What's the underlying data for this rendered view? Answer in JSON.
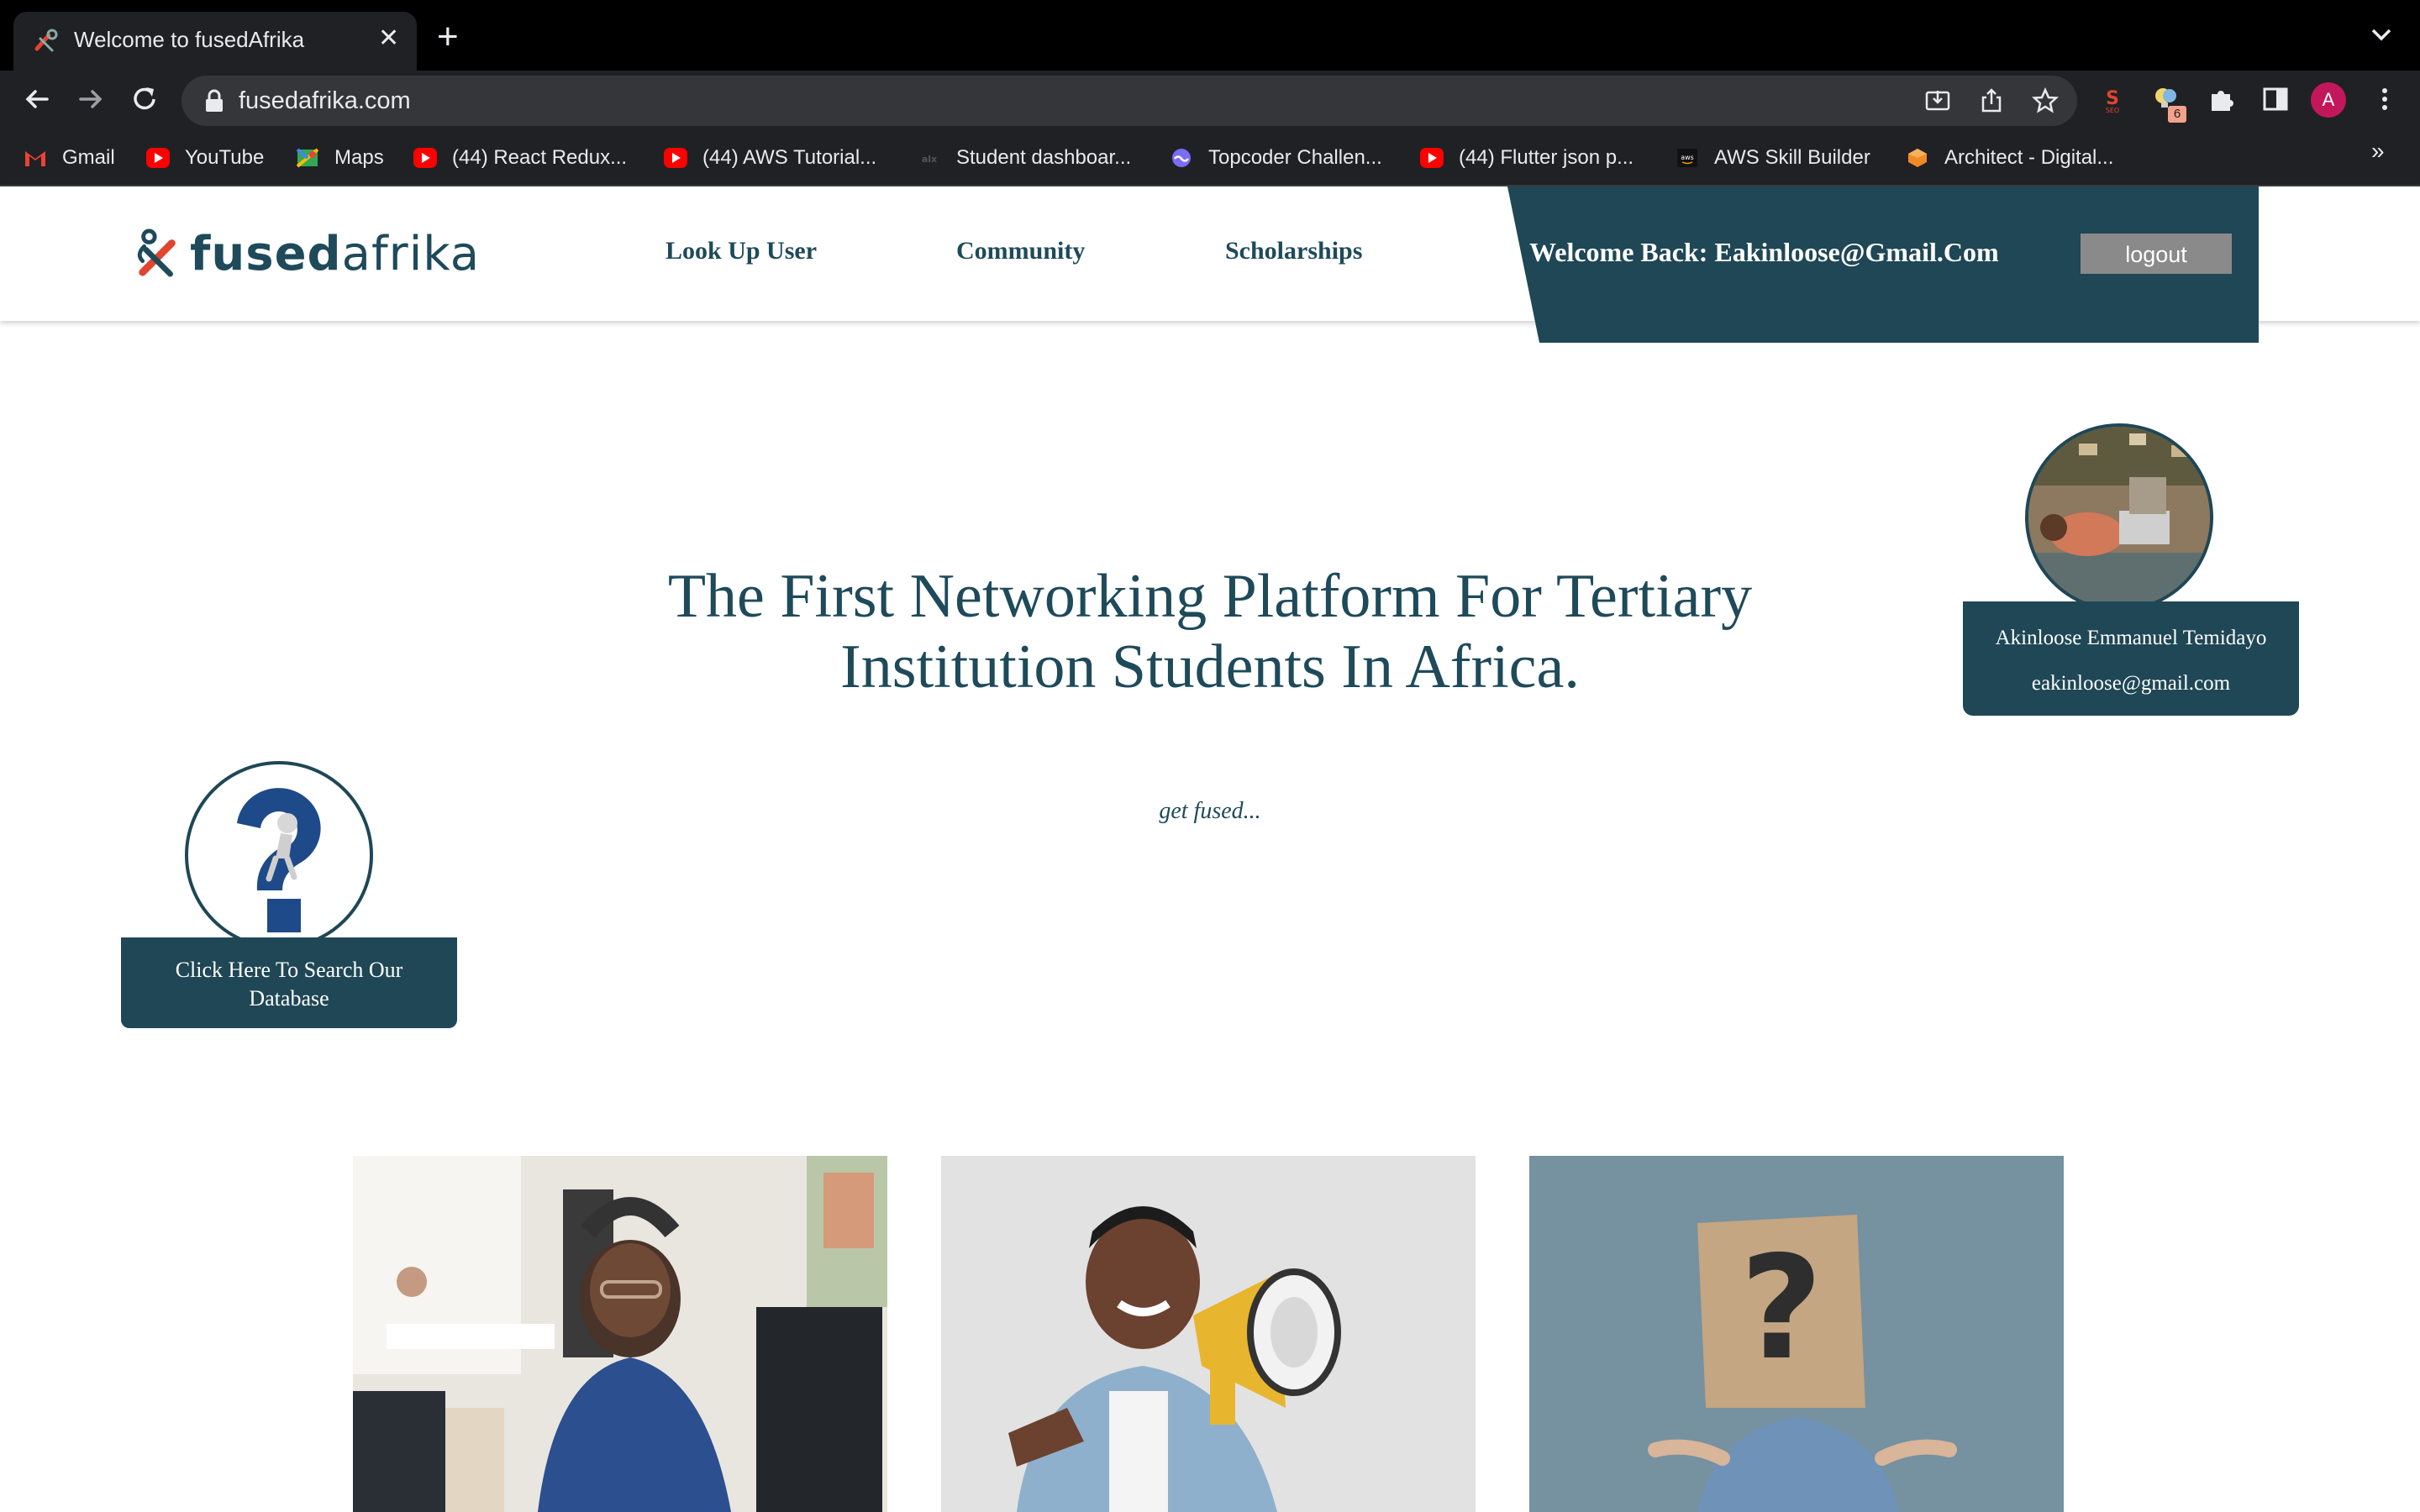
{
  "browser": {
    "tab_title": "Welcome to fusedAfrika",
    "url": "fusedafrika.com",
    "profile_initial": "A",
    "extension_badge": "6",
    "bookmarks": [
      {
        "label": "Gmail",
        "icon": "gmail-icon"
      },
      {
        "label": "YouTube",
        "icon": "youtube-icon"
      },
      {
        "label": "Maps",
        "icon": "maps-icon"
      },
      {
        "label": "(44) React Redux...",
        "icon": "youtube-icon"
      },
      {
        "label": "(44) AWS Tutorial...",
        "icon": "youtube-icon"
      },
      {
        "label": "Student dashboar...",
        "icon": "alx-icon"
      },
      {
        "label": "Topcoder Challen...",
        "icon": "topcoder-icon"
      },
      {
        "label": "(44) Flutter json p...",
        "icon": "youtube-icon"
      },
      {
        "label": "AWS Skill Builder",
        "icon": "aws-icon"
      },
      {
        "label": "Architect - Digital...",
        "icon": "architect-icon"
      }
    ],
    "more_bookmarks": "»"
  },
  "site": {
    "logo": {
      "bold": "fused",
      "light": "afrika"
    },
    "nav": [
      "Look Up User",
      "Community",
      "Scholarships"
    ],
    "welcome": "Welcome Back: Eakinloose@Gmail.Com",
    "logout": "logout",
    "hero": {
      "line1": "The First Networking Platform For Tertiary",
      "line2": "Institution Students In Africa.",
      "tagline": "get fused..."
    },
    "profile": {
      "name": "Akinloose Emmanuel Temidayo",
      "email": "eakinloose@gmail.com"
    },
    "search_card": "Click Here To Search Our Database"
  },
  "colors": {
    "brand": "#1f4756",
    "accent_red": "#e0452f",
    "chrome_bg": "#202124"
  }
}
